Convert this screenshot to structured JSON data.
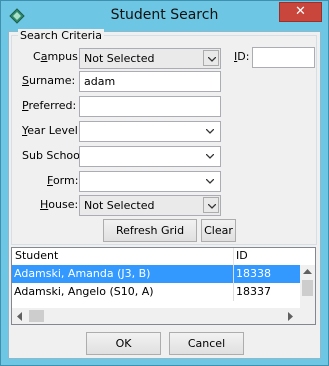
{
  "window": {
    "title": "Student Search",
    "close_glyph": "✕"
  },
  "criteria": {
    "legend": "Search Criteria",
    "campus": {
      "label_pre": "C",
      "label_u": "a",
      "label_post": "mpus:",
      "value": "Not Selected"
    },
    "id": {
      "label_u": "I",
      "label_post": "D:",
      "value": ""
    },
    "surname": {
      "label_u": "S",
      "label_post": "urname:",
      "value": "adam"
    },
    "preferred": {
      "label_u": "P",
      "label_post": "referred:",
      "value": ""
    },
    "year_level": {
      "label_u": "Y",
      "label_post": "ear Level:",
      "value": ""
    },
    "sub_school": {
      "label": "Sub School:",
      "value": ""
    },
    "form": {
      "label_u": "F",
      "label_post": "orm:",
      "value": ""
    },
    "house": {
      "label_u": "H",
      "label_post": "ouse:",
      "value": "Not Selected"
    }
  },
  "buttons": {
    "refresh": "Refresh Grid",
    "clear": "Clear",
    "ok": "OK",
    "cancel": "Cancel"
  },
  "grid": {
    "columns": [
      "Student",
      "ID"
    ],
    "rows": [
      {
        "student": "Adamski, Amanda (J3, B)",
        "id": "18338",
        "selected": true
      },
      {
        "student": "Adamski, Angelo (S10, A)",
        "id": "18337",
        "selected": false
      }
    ]
  },
  "colors": {
    "accent_frame": "#6dc6e3",
    "close_button": "#c9463d",
    "selection": "#3399ff"
  },
  "icons": [
    "app-icon",
    "close-icon",
    "chevron-down-icon",
    "scroll-arrow-icons"
  ]
}
